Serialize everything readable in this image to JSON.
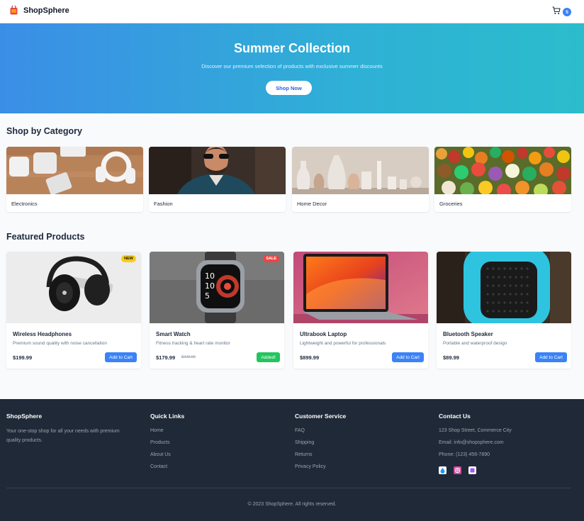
{
  "header": {
    "logo_text": "ShopSphere",
    "cart_count": "5"
  },
  "hero": {
    "title": "Summer Collection",
    "subtitle": "Discover our premium selection of products with exclusive summer discounts",
    "button": "Shop Now"
  },
  "categories": {
    "title": "Shop by Category",
    "items": [
      {
        "label": "Electronics"
      },
      {
        "label": "Fashion"
      },
      {
        "label": "Home Decor"
      },
      {
        "label": "Groceries"
      }
    ]
  },
  "products": {
    "title": "Featured Products",
    "items": [
      {
        "name": "Wireless Headphones",
        "desc": "Premium sound quality with noise cancellation",
        "price": "$199.99",
        "old_price": "",
        "button": "Add to Cart",
        "badge": "NEW"
      },
      {
        "name": "Smart Watch",
        "desc": "Fitness tracking & heart rate monitor",
        "price": "$179.99",
        "old_price": "$229.99",
        "button": "Added!",
        "badge": "SALE"
      },
      {
        "name": "Ultrabook Laptop",
        "desc": "Lightweight and powerful for professionals",
        "price": "$899.99",
        "old_price": "",
        "button": "Add to Cart",
        "badge": ""
      },
      {
        "name": "Bluetooth Speaker",
        "desc": "Portable and waterproof design",
        "price": "$89.99",
        "old_price": "",
        "button": "Add to Cart",
        "badge": ""
      }
    ]
  },
  "footer": {
    "brand": {
      "title": "ShopSphere",
      "text": "Your one-stop shop for all your needs with premium quality products."
    },
    "quick_links": {
      "title": "Quick Links",
      "links": [
        "Home",
        "Products",
        "About Us",
        "Contact"
      ]
    },
    "customer_service": {
      "title": "Customer Service",
      "links": [
        "FAQ",
        "Shipping",
        "Returns",
        "Privacy Policy"
      ]
    },
    "contact": {
      "title": "Contact Us",
      "address": "123 Shop Street, Commerce City",
      "email": "Email: info@shopsphere.com",
      "phone": "Phone: (123) 456-7890"
    },
    "copyright": "© 2023 ShopSphere. All rights reserved."
  },
  "colors": {
    "accent": "#3b82f6",
    "added": "#22c55e",
    "badge_new": "#facc15",
    "badge_sale": "#ef4444",
    "footer_bg": "#1f2937"
  }
}
